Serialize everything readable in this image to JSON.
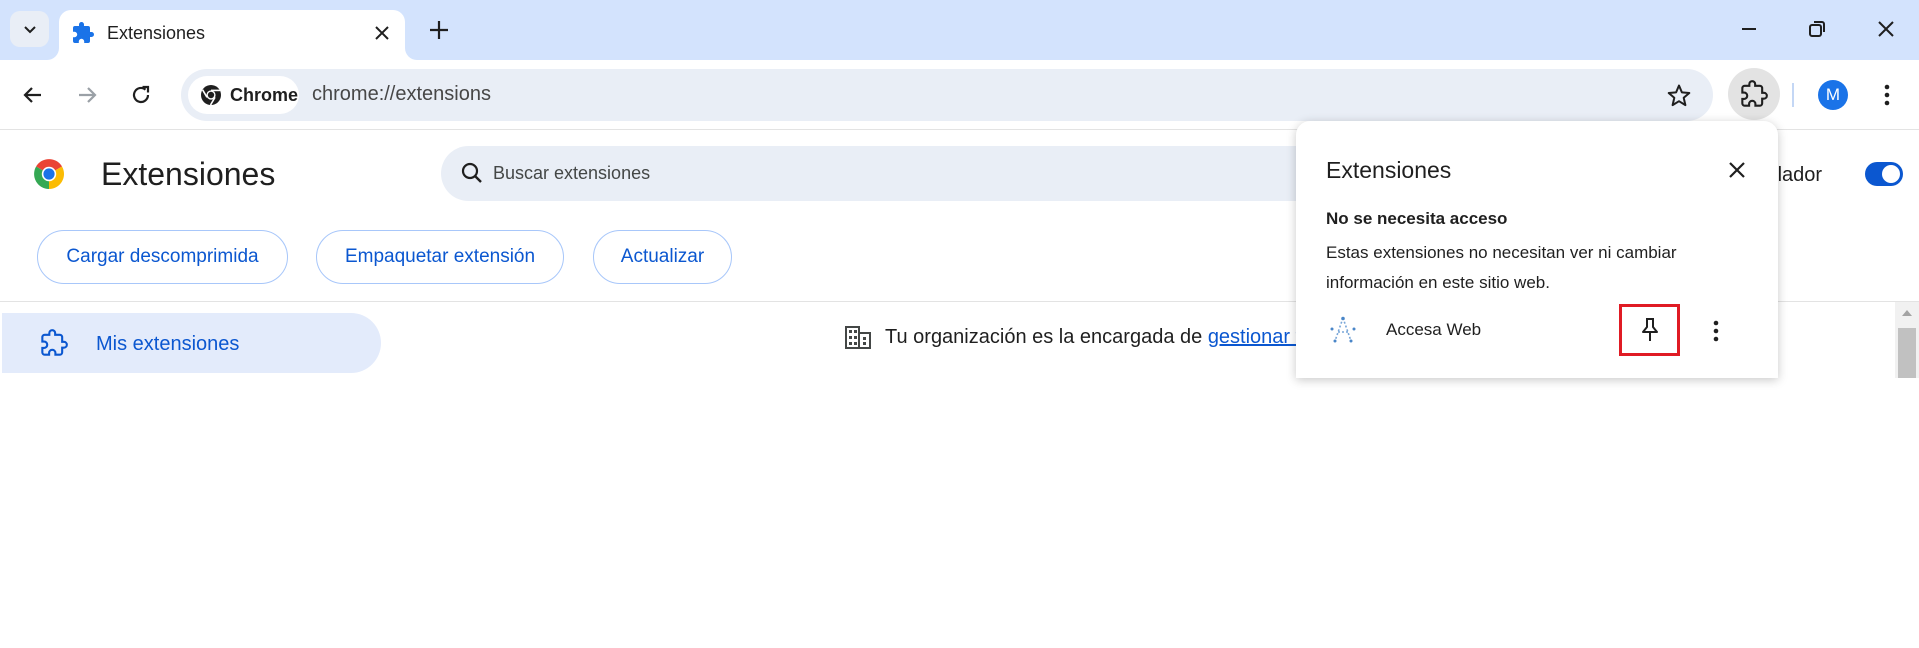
{
  "tab": {
    "title": "Extensiones",
    "icon": "puzzle-icon"
  },
  "omnibox": {
    "chip_label": "Chrome",
    "url": "chrome://extensions"
  },
  "profile": {
    "initial": "M",
    "color": "#1a73e8"
  },
  "page": {
    "title": "Extensiones",
    "search_placeholder": "Buscar extensiones",
    "dev_mode_label": "Modo de desarrollador",
    "dev_mode_visible_label": "ollador",
    "dev_mode_enabled": true,
    "actions": [
      {
        "label": "Cargar descomprimida"
      },
      {
        "label": "Empaquetar extensión"
      },
      {
        "label": "Actualizar"
      }
    ],
    "sidebar": {
      "items": [
        {
          "label": "Mis extensiones",
          "icon": "puzzle-icon",
          "selected": true
        }
      ]
    },
    "org_notice": {
      "text": "Tu organización es la encargada de",
      "link": "gestionar tu"
    }
  },
  "popup": {
    "title": "Extensiones",
    "section_title": "No se necesita acceso",
    "section_desc": "Estas extensiones no necesitan ver ni cambiar información en este sitio web.",
    "extensions": [
      {
        "name": "Accesa Web",
        "pinned": false
      }
    ]
  },
  "colors": {
    "accent": "#0b57d0",
    "tabstrip": "#d3e3fd",
    "highlight": "#e01b24"
  }
}
